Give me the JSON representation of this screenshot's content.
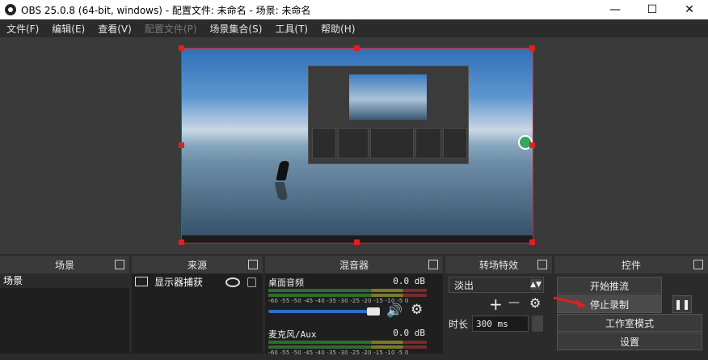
{
  "window": {
    "title": "OBS 25.0.8 (64-bit, windows) - 配置文件: 未命名 - 场景: 未命名",
    "minimize_glyph": "—",
    "maximize_glyph": "☐",
    "close_glyph": "✕"
  },
  "menu": [
    {
      "label": "文件(F)",
      "disabled": false
    },
    {
      "label": "编辑(E)",
      "disabled": false
    },
    {
      "label": "查看(V)",
      "disabled": false
    },
    {
      "label": "配置文件(P)",
      "disabled": true
    },
    {
      "label": "场景集合(S)",
      "disabled": false
    },
    {
      "label": "工具(T)",
      "disabled": false
    },
    {
      "label": "帮助(H)",
      "disabled": false
    }
  ],
  "docks": {
    "scenes": {
      "title": "场景",
      "items": [
        "场景"
      ]
    },
    "sources": {
      "title": "来源",
      "items": [
        {
          "label": "显示器捕获",
          "icon": "monitor-icon"
        }
      ]
    },
    "mixer": {
      "title": "混音器",
      "channels": [
        {
          "name": "桌面音频",
          "db": "0.0 dB"
        },
        {
          "name": "麦克风/Aux",
          "db": "0.0 dB"
        }
      ],
      "ticks": "-60 -55 -50 -45 -40 -35 -30 -25 -20 -15 -10 -5 0"
    },
    "transitions": {
      "title": "转场特效",
      "selected": "淡出",
      "add": "+",
      "remove": "—",
      "duration_label": "时长",
      "duration_value": "300 ms"
    },
    "controls": {
      "title": "控件",
      "buttons": [
        "开始推流",
        "停止录制",
        "工作室模式",
        "设置"
      ]
    }
  },
  "colors": {
    "selection": "#e02020",
    "meter_green": "#2e6b2e",
    "volume_blue": "#2d6fc9"
  }
}
